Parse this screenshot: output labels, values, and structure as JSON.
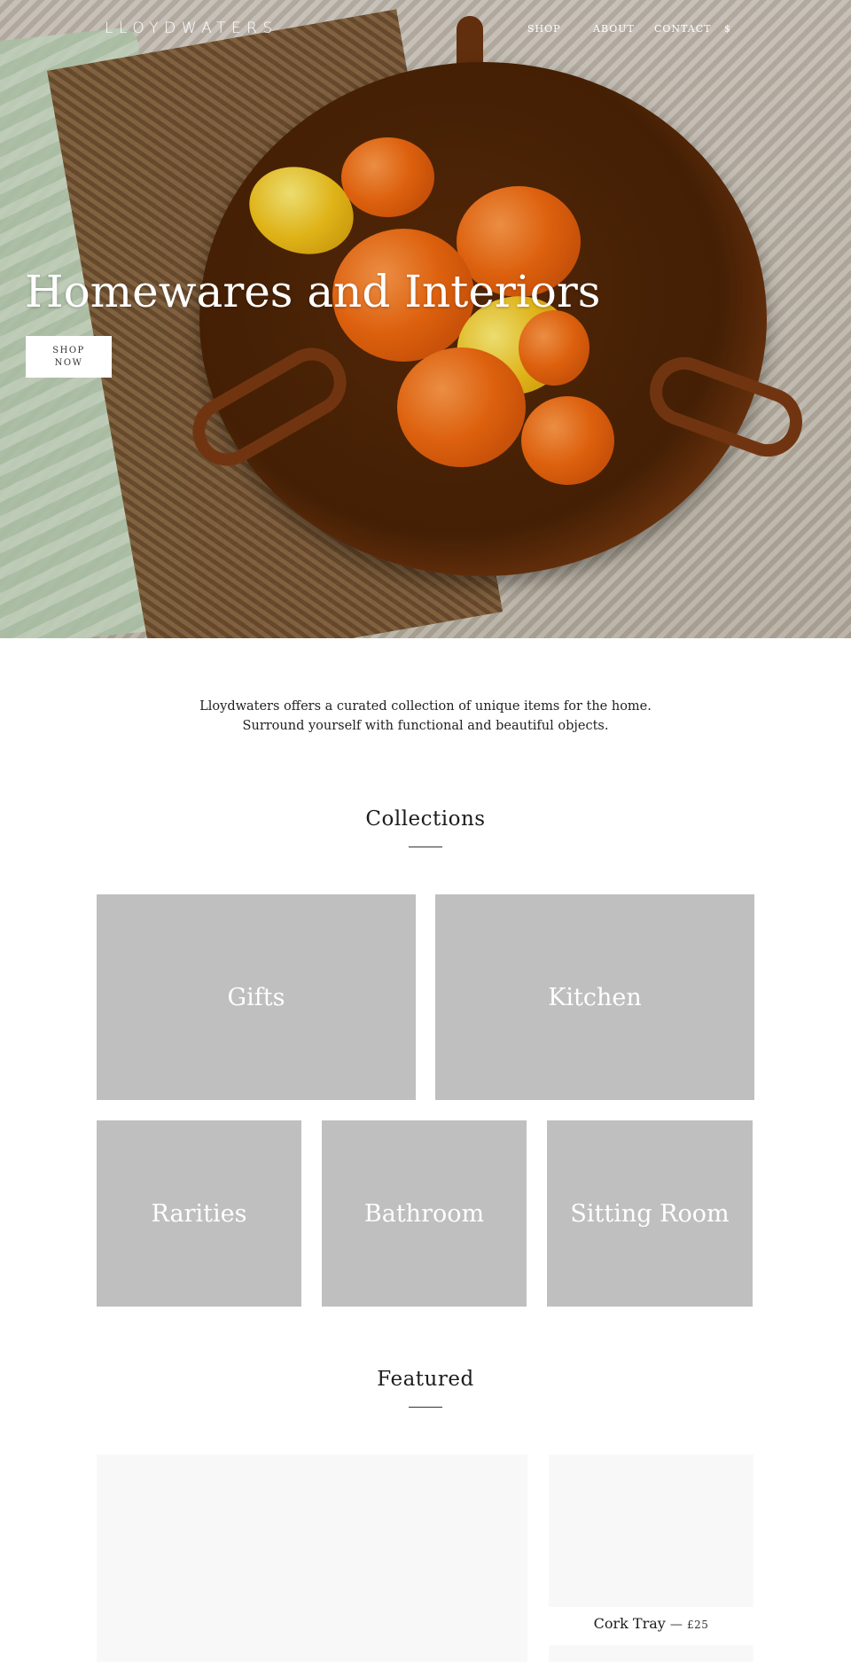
{
  "header": {
    "logo": "LLOYDWATERS",
    "nav": [
      {
        "label": "SHOP"
      },
      {
        "label": "ABOUT"
      },
      {
        "label": "CONTACT"
      },
      {
        "label": "$"
      }
    ]
  },
  "hero": {
    "title": "Homewares and Interiors",
    "button_line1": "SHOP",
    "button_line2": "NOW"
  },
  "intro": {
    "line1": "Lloydwaters offers a curated collection of unique items for the home.",
    "line2": "Surround yourself with functional and beautiful objects."
  },
  "collections": {
    "title": "Collections",
    "items": [
      {
        "label": "Gifts"
      },
      {
        "label": "Kitchen"
      },
      {
        "label": "Rarities"
      },
      {
        "label": "Bathroom"
      },
      {
        "label": "Sitting Room"
      }
    ]
  },
  "featured": {
    "title": "Featured",
    "products": [
      {
        "name": "Cork Tray",
        "separator": "—",
        "price": "£25"
      }
    ]
  },
  "colors": {
    "tile_bg": "#bfbfbf",
    "placeholder_bg": "#f8f8f8",
    "text": "#1c1c1c"
  }
}
